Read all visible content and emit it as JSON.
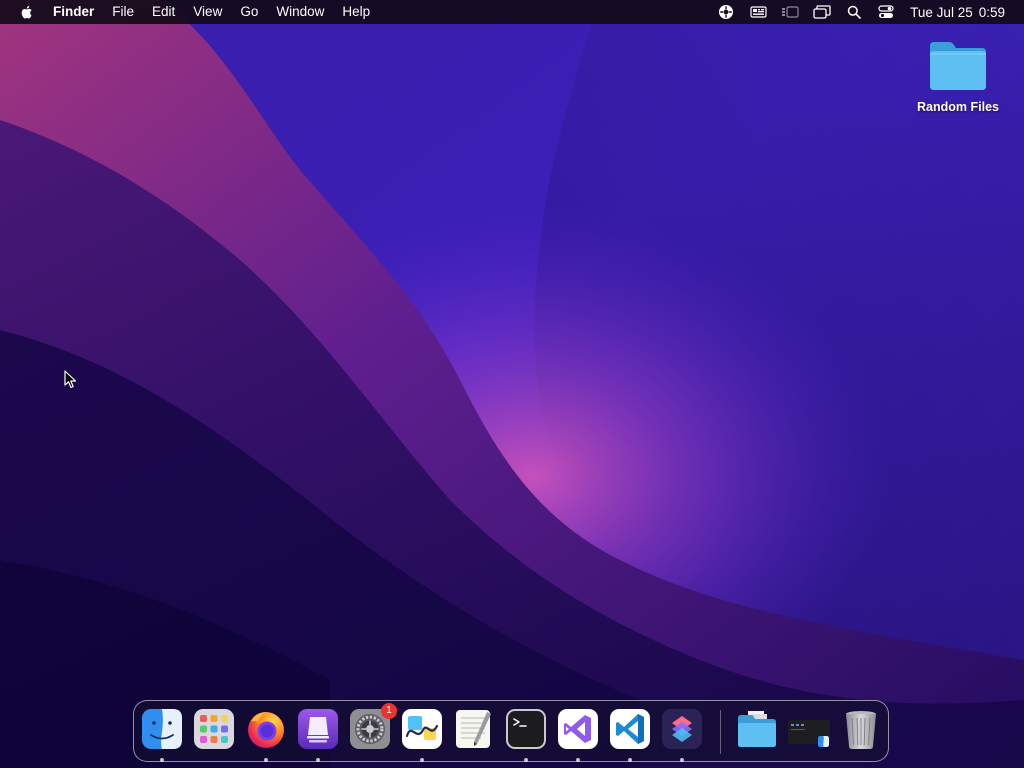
{
  "menubar": {
    "app_name": "Finder",
    "menus": [
      "File",
      "Edit",
      "View",
      "Go",
      "Window",
      "Help"
    ],
    "clock": {
      "date": "Tue Jul 25",
      "time": "0:59"
    },
    "status_icons": [
      "wheel-icon",
      "keyboard-viewer-icon",
      "stage-manager-icon",
      "screen-mirroring-icon",
      "spotlight-search-icon",
      "control-center-icon"
    ]
  },
  "desktop": {
    "folder": {
      "label": "Random Files",
      "color": "#4fb3ea"
    }
  },
  "dock": {
    "apps": [
      {
        "name": "Finder",
        "icon": "finder-icon",
        "running": true
      },
      {
        "name": "Launchpad",
        "icon": "launchpad-icon",
        "running": false
      },
      {
        "name": "Firefox",
        "icon": "firefox-icon",
        "running": true
      },
      {
        "name": "Apple Configurator",
        "icon": "apple-configurator-icon",
        "running": true
      },
      {
        "name": "System Settings",
        "icon": "system-settings-icon",
        "running": false,
        "badge": "1"
      },
      {
        "name": "Freeform",
        "icon": "freeform-icon",
        "running": true
      },
      {
        "name": "TextEdit",
        "icon": "textedit-icon",
        "running": false
      },
      {
        "name": "Terminal",
        "icon": "terminal-icon",
        "running": true
      },
      {
        "name": "Visual Studio",
        "icon": "visual-studio-icon",
        "running": true
      },
      {
        "name": "Visual Studio Code",
        "icon": "vscode-icon",
        "running": true
      },
      {
        "name": "Shortcuts",
        "icon": "shortcuts-icon",
        "running": true
      }
    ],
    "others": [
      {
        "name": "Downloads",
        "icon": "downloads-folder-icon"
      },
      {
        "name": "Finder Window",
        "icon": "finder-window-icon"
      },
      {
        "name": "Trash",
        "icon": "trash-icon"
      }
    ]
  },
  "colors": {
    "badge": "#e8362e",
    "folder": "#4fb3ea",
    "wallpaper_dark": "#1c0a52",
    "wallpaper_accent": "#c02a8a"
  }
}
